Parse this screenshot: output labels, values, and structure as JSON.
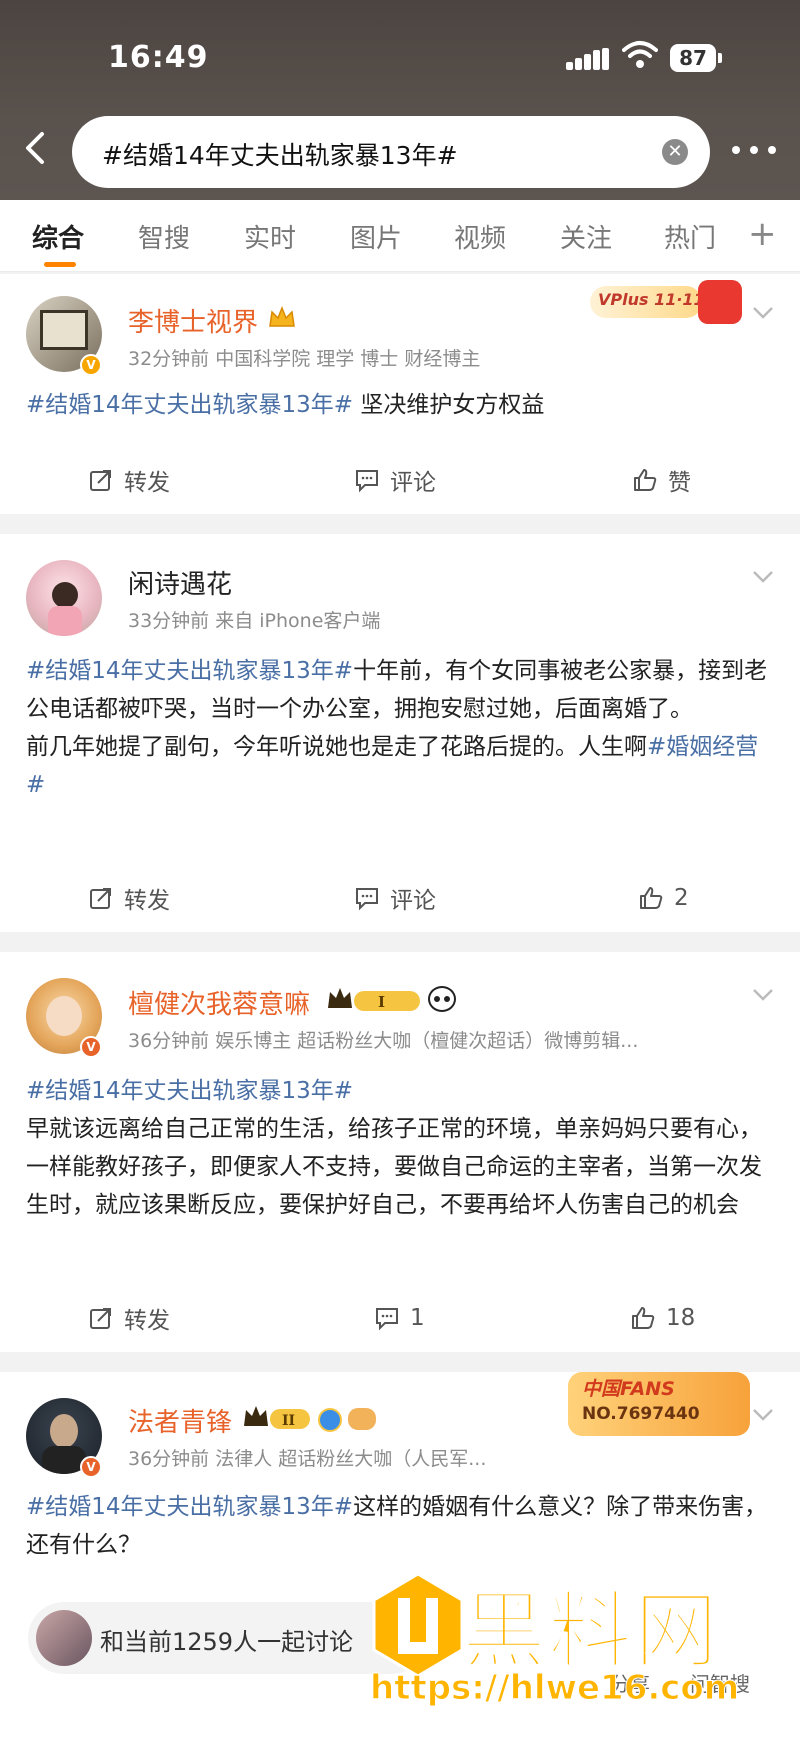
{
  "status_bar": {
    "time": "16:49",
    "battery": "87"
  },
  "search": {
    "query": "#结婚14年丈夫出轨家暴13年#"
  },
  "tabs": [
    {
      "label": "综合"
    },
    {
      "label": "智搜"
    },
    {
      "label": "实时"
    },
    {
      "label": "图片"
    },
    {
      "label": "视频"
    },
    {
      "label": "关注"
    },
    {
      "label": "热门"
    }
  ],
  "posts": [
    {
      "username": "李博士视界",
      "meta": "32分钟前  中国科学院  理学 博士 财经博主",
      "badge": "VPlus 11·11",
      "tag": "#结婚14年丈夫出轨家暴13年#",
      "text": " 坚决维护女方权益",
      "repost": "转发",
      "comment": "评论",
      "like": "赞"
    },
    {
      "username": "闲诗遇花",
      "meta": "33分钟前  来自 iPhone客户端",
      "tag": "#结婚14年丈夫出轨家暴13年#",
      "text": "十年前，有个女同事被老公家暴，接到老公电话都被吓哭，当时一个办公室，拥抱安慰过她，后面离婚了。",
      "text2": "前几年她提了副句，今年听说她也是走了花路后提的。人生啊",
      "tag2": "#婚姻经营#",
      "repost": "转发",
      "comment": "评论",
      "like": "2"
    },
    {
      "username": "檀健次我蓉意嘛",
      "meta": "36分钟前  娱乐博主 超话粉丝大咖（檀健次超话）微博剪辑...",
      "tag": "#结婚14年丈夫出轨家暴13年#",
      "text": "早就该远离给自己正常的生活，给孩子正常的环境，单亲妈妈只要有心，一样能教好孩子，即便家人不支持，要做自己命运的主宰者，当第一次发生时，就应该果断反应，要保护好自己，不要再给坏人伤害自己的机会",
      "repost": "转发",
      "comment": "1",
      "like": "18"
    },
    {
      "username": "法者青锋",
      "meta": "36分钟前  法律人 超话粉丝大咖（人民军...",
      "fans_badge_title": "中国FANS",
      "fans_badge_no": "NO.7697440",
      "tag": "#结婚14年丈夫出轨家暴13年#",
      "text": "这样的婚姻有什么意义？除了带来伤害，还有什么？"
    }
  ],
  "bottom_bar": {
    "discuss": "和当前1259人一起讨论",
    "share": "分享",
    "ask": "问智搜"
  },
  "watermark": {
    "brand": "黑料网",
    "url": "https://hlwe16.com"
  },
  "colors": {
    "accent": "#ff8200",
    "tag_blue": "#4a6fa5",
    "vip_orange": "#e8632a",
    "header": "#4b4440"
  }
}
